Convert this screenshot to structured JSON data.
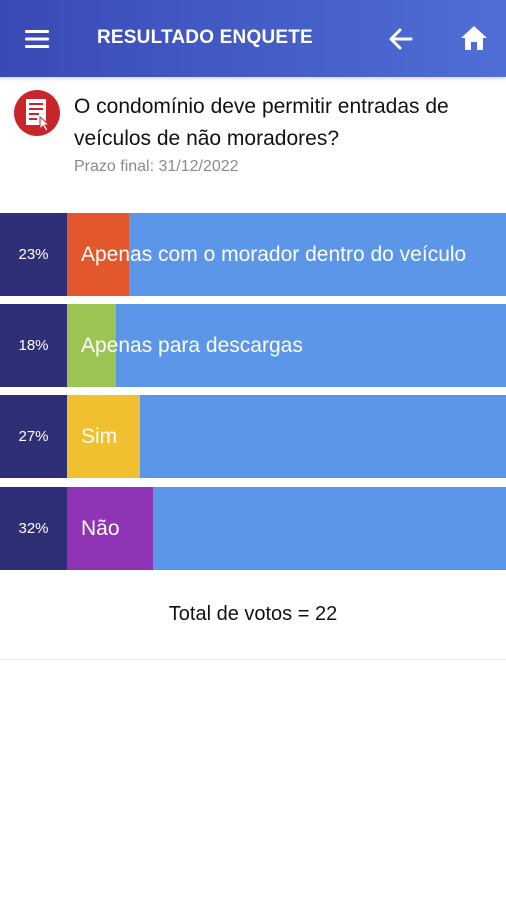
{
  "header": {
    "title": "RESULTADO ENQUETE",
    "menu_icon": "menu-icon",
    "back_icon": "arrow-left-icon",
    "home_icon": "home-icon"
  },
  "question": {
    "text": "O condomínio deve permitir entradas de veículos de não moradores?",
    "deadline": "Prazo final: 31/12/2022",
    "icon": "poll-document-icon"
  },
  "options": [
    {
      "percent_label": "23%",
      "percent": 23,
      "label": "Apenas com o morador dentro do veículo",
      "color": "#e2572b"
    },
    {
      "percent_label": "18%",
      "percent": 18,
      "label": "Apenas para descargas",
      "color": "#9bc455"
    },
    {
      "percent_label": "27%",
      "percent": 27,
      "label": "Sim",
      "color": "#f0c030"
    },
    {
      "percent_label": "32%",
      "percent": 32,
      "label": "Não",
      "color": "#8e34b4"
    }
  ],
  "footer": {
    "total_votes": "Total de votos = 22"
  },
  "colors": {
    "appbar_start": "#3949b5",
    "appbar_end": "#4f6fd6",
    "bar_background": "#5b96e9",
    "percent_box": "#2f2f78"
  }
}
